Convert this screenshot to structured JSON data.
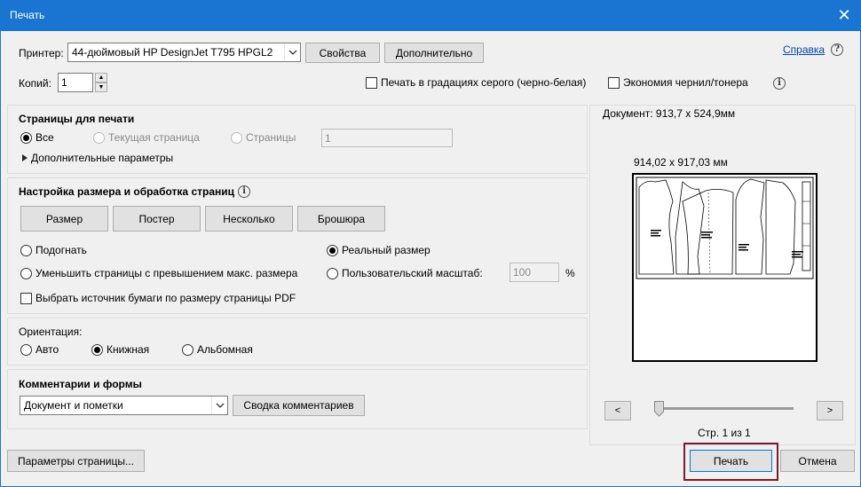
{
  "window": {
    "title": "Печать",
    "close_glyph": "✕"
  },
  "printer": {
    "label": "Принтер:",
    "selected": "44-дюймовый HP DesignJet T795 HPGL2",
    "properties_button": "Свойства",
    "advanced_button": "Дополнительно",
    "help_link": "Справка"
  },
  "copies": {
    "label": "Копий:",
    "value": "1"
  },
  "options": {
    "grayscale_label": "Печать в градациях серого (черно-белая)",
    "grayscale_checked": false,
    "save_ink_label": "Экономия чернил/тонера",
    "save_ink_checked": false
  },
  "pages_to_print": {
    "title": "Страницы для печати",
    "all_label": "Все",
    "current_label": "Текущая страница",
    "pages_label": "Страницы",
    "pages_value": "1",
    "more_options_label": "Дополнительные параметры",
    "selected": "all"
  },
  "sizing": {
    "title": "Настройка размера и обработка страниц",
    "tabs": [
      "Размер",
      "Постер",
      "Несколько",
      "Брошюра"
    ],
    "fit_label": "Подогнать",
    "actual_size_label": "Реальный размер",
    "shrink_label": "Уменьшить страницы с превышением макс. размера",
    "custom_scale_label": "Пользовательский масштаб:",
    "scale_value": "100",
    "percent_sign": "%",
    "paper_source_label": "Выбрать источник бумаги по размеру страницы PDF",
    "selected": "actual"
  },
  "orientation": {
    "title": "Ориентация:",
    "auto_label": "Авто",
    "portrait_label": "Книжная",
    "landscape_label": "Альбомная",
    "selected": "portrait"
  },
  "comments": {
    "title": "Комментарии и формы",
    "selected": "Документ и пометки",
    "summary_button": "Сводка комментариев"
  },
  "preview": {
    "document_size": "Документ: 913,7 x 524,9мм",
    "page_size": "914,02 x 917,03 мм",
    "prev_label": "<",
    "next_label": ">",
    "page_counter": "Стр. 1 из 1"
  },
  "footer": {
    "page_setup_button": "Параметры страницы...",
    "print_button": "Печать",
    "cancel_button": "Отмена"
  },
  "colors": {
    "titlebar": "#1a75d2",
    "dialog_bg": "#f0f0f0",
    "print_focus": "#7b1b2b",
    "link": "#0645ad"
  },
  "icons": {
    "info": "info-icon",
    "help": "help-icon",
    "expander": "triangle-right-icon",
    "dropdown": "chevron-down-icon"
  },
  "glyphs": {
    "info": "i",
    "help": "?"
  }
}
